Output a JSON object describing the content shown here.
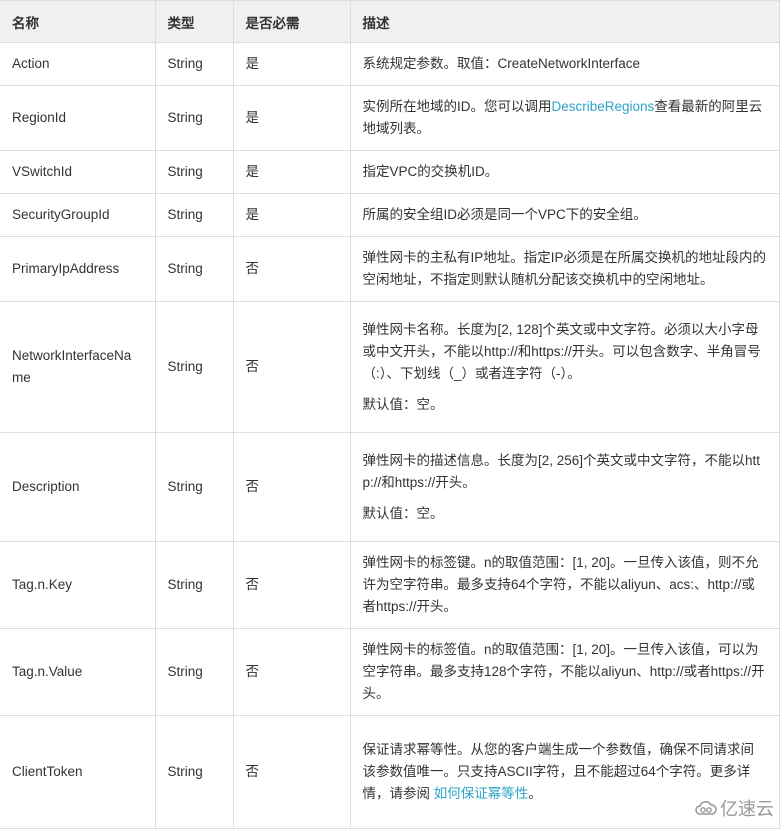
{
  "table": {
    "headers": [
      "名称",
      "类型",
      "是否必需",
      "描述"
    ],
    "rows": [
      {
        "name": "Action",
        "type": "String",
        "required": "是",
        "desc": [
          "系统规定参数。取值：CreateNetworkInterface"
        ]
      },
      {
        "name": "RegionId",
        "type": "String",
        "required": "是",
        "desc_pre": "实例所在地域的ID。您可以调用",
        "desc_link": "DescribeRegions",
        "desc_post": "查看最新的阿里云地域列表。"
      },
      {
        "name": "VSwitchId",
        "type": "String",
        "required": "是",
        "desc": [
          "指定VPC的交换机ID。"
        ]
      },
      {
        "name": "SecurityGroupId",
        "type": "String",
        "required": "是",
        "desc": [
          "所属的安全组ID必须是同一个VPC下的安全组。"
        ]
      },
      {
        "name": "PrimaryIpAddress",
        "type": "String",
        "required": "否",
        "desc": [
          "弹性网卡的主私有IP地址。指定IP必须是在所属交换机的地址段内的空闲地址，不指定则默认随机分配该交换机中的空闲地址。"
        ]
      },
      {
        "name": "NetworkInterfaceName",
        "type": "String",
        "required": "否",
        "desc": [
          "弹性网卡名称。长度为[2, 128]个英文或中文字符。必须以大小字母或中文开头，不能以http://和https://开头。可以包含数字、半角冒号（:）、下划线（_）或者连字符（-）。",
          "默认值：空。"
        ]
      },
      {
        "name": "Description",
        "type": "String",
        "required": "否",
        "desc": [
          "弹性网卡的描述信息。长度为[2, 256]个英文或中文字符，不能以http://和https://开头。",
          "默认值：空。"
        ]
      },
      {
        "name": "Tag.n.Key",
        "type": "String",
        "required": "否",
        "desc": [
          "弹性网卡的标签键。n的取值范围：[1, 20]。一旦传入该值，则不允许为空字符串。最多支持64个字符，不能以aliyun、acs:、http://或者https://开头。"
        ]
      },
      {
        "name": "Tag.n.Value",
        "type": "String",
        "required": "否",
        "desc": [
          "弹性网卡的标签值。n的取值范围：[1, 20]。一旦传入该值，可以为空字符串。最多支持128个字符，不能以aliyun、http://或者https://开头。"
        ]
      },
      {
        "name": "ClientToken",
        "type": "String",
        "required": "否",
        "desc_pre": "保证请求幂等性。从您的客户端生成一个参数值，确保不同请求间该参数值唯一。只支持ASCII字符，且不能超过64个字符。更多详情，请参阅 ",
        "desc_link": "如何保证幂等性",
        "desc_post": "。"
      }
    ]
  },
  "watermark": {
    "icon": "cloud-logo-icon",
    "text": "亿速云"
  },
  "colors": {
    "link": "#2ea4c7",
    "header_bg": "#f0f0f0",
    "border": "#dddddd",
    "text": "#333333"
  }
}
